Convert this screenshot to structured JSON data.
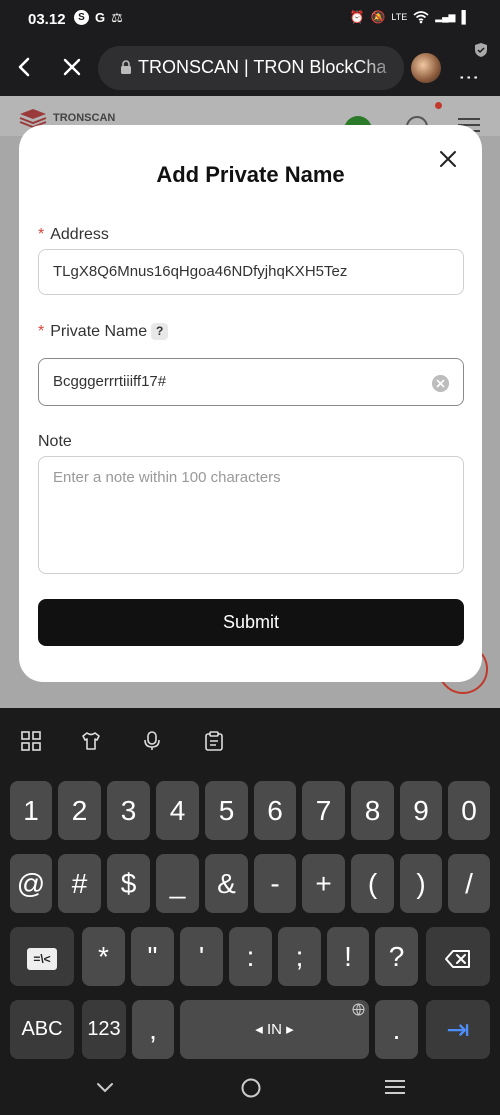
{
  "status_bar": {
    "time": "03.12",
    "left_icons": [
      "S",
      "G",
      "⚖"
    ],
    "right_icons": [
      "⏰",
      "🔕",
      "LTE",
      "wifi",
      "▂▄▆",
      "▌"
    ]
  },
  "browser": {
    "url_text": "TRONSCAN | TRON BlockCha",
    "menu": "⋮"
  },
  "page": {
    "site_name": "TRONSCAN"
  },
  "modal": {
    "title": "Add Private Name",
    "address": {
      "label": "Address",
      "required_mark": "*",
      "value": "TLgX8Q6Mnus16qHgoa46NDfyjhqKXH5Tez"
    },
    "private_name": {
      "label": "Private Name",
      "required_mark": "*",
      "help": "?",
      "value": "Bcgggerrrtiiiff17#"
    },
    "note": {
      "label": "Note",
      "placeholder": "Enter a note within 100 characters",
      "value": ""
    },
    "submit_label": "Submit"
  },
  "keyboard": {
    "row1": [
      "1",
      "2",
      "3",
      "4",
      "5",
      "6",
      "7",
      "8",
      "9",
      "0"
    ],
    "row2": [
      "@",
      "#",
      "$",
      "_",
      "&",
      "-",
      "+",
      "(",
      ")",
      "/"
    ],
    "row3": [
      "*",
      "\"",
      "'",
      ":",
      ";",
      "!",
      "?"
    ],
    "symbols_toggle": "=\\<",
    "abc_key": "ABC",
    "num_key": "123",
    "comma_key": ",",
    "space_label": "◂ IN ▸",
    "period_key": ".",
    "tab_key": "⇥"
  },
  "colors": {
    "accent_blue": "#4d8dfa",
    "required_red": "#d8453b",
    "button_dark": "#111111"
  }
}
